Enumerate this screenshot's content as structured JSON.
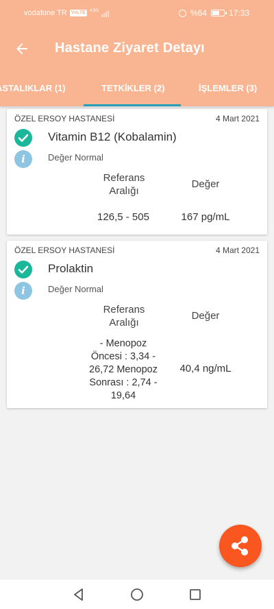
{
  "status_bar": {
    "carrier": "vodafone TR",
    "volte": "VoLTE",
    "network": "4.5G",
    "battery": "%64",
    "time": "17:33"
  },
  "header": {
    "title": "Hastane Ziyaret Detayı",
    "back_icon": "arrow-left-icon"
  },
  "tabs": [
    {
      "label": "ASTALIKLAR (1)"
    },
    {
      "label": "TETKİKLER (2)",
      "selected": true
    },
    {
      "label": "İŞLEMLER (3)"
    }
  ],
  "colors": {
    "primary": "#f9b592",
    "tab_indicator": "#2a9fb8",
    "check": "#1bb79a",
    "info": "#8ec5e2",
    "fab": "#f9571f"
  },
  "results": [
    {
      "hospital": "ÖZEL ERSOY HASTANESİ",
      "date": "4 Mart 2021",
      "test": "Vitamin B12 (Kobalamin)",
      "status": "Değer Normal",
      "ref_header": "Referans Aralığı",
      "value_header": "Değer",
      "ref_range": "126,5 - 505",
      "value": "167 pg/mL"
    },
    {
      "hospital": "ÖZEL ERSOY HASTANESİ",
      "date": "4 Mart 2021",
      "test": "Prolaktin",
      "status": "Değer Normal",
      "ref_header": "Referans Aralığı",
      "value_header": "Değer",
      "ref_range": "-   Menopoz Öncesi  : 3,34 - 26,72 Menopoz Sonrası : 2,74 - 19,64",
      "value": "40,4 ng/mL"
    }
  ],
  "fab": {
    "icon": "share-icon"
  },
  "nav_bar": {
    "back_icon": "triangle-back-icon",
    "home_icon": "circle-home-icon",
    "recent_icon": "square-recents-icon"
  }
}
